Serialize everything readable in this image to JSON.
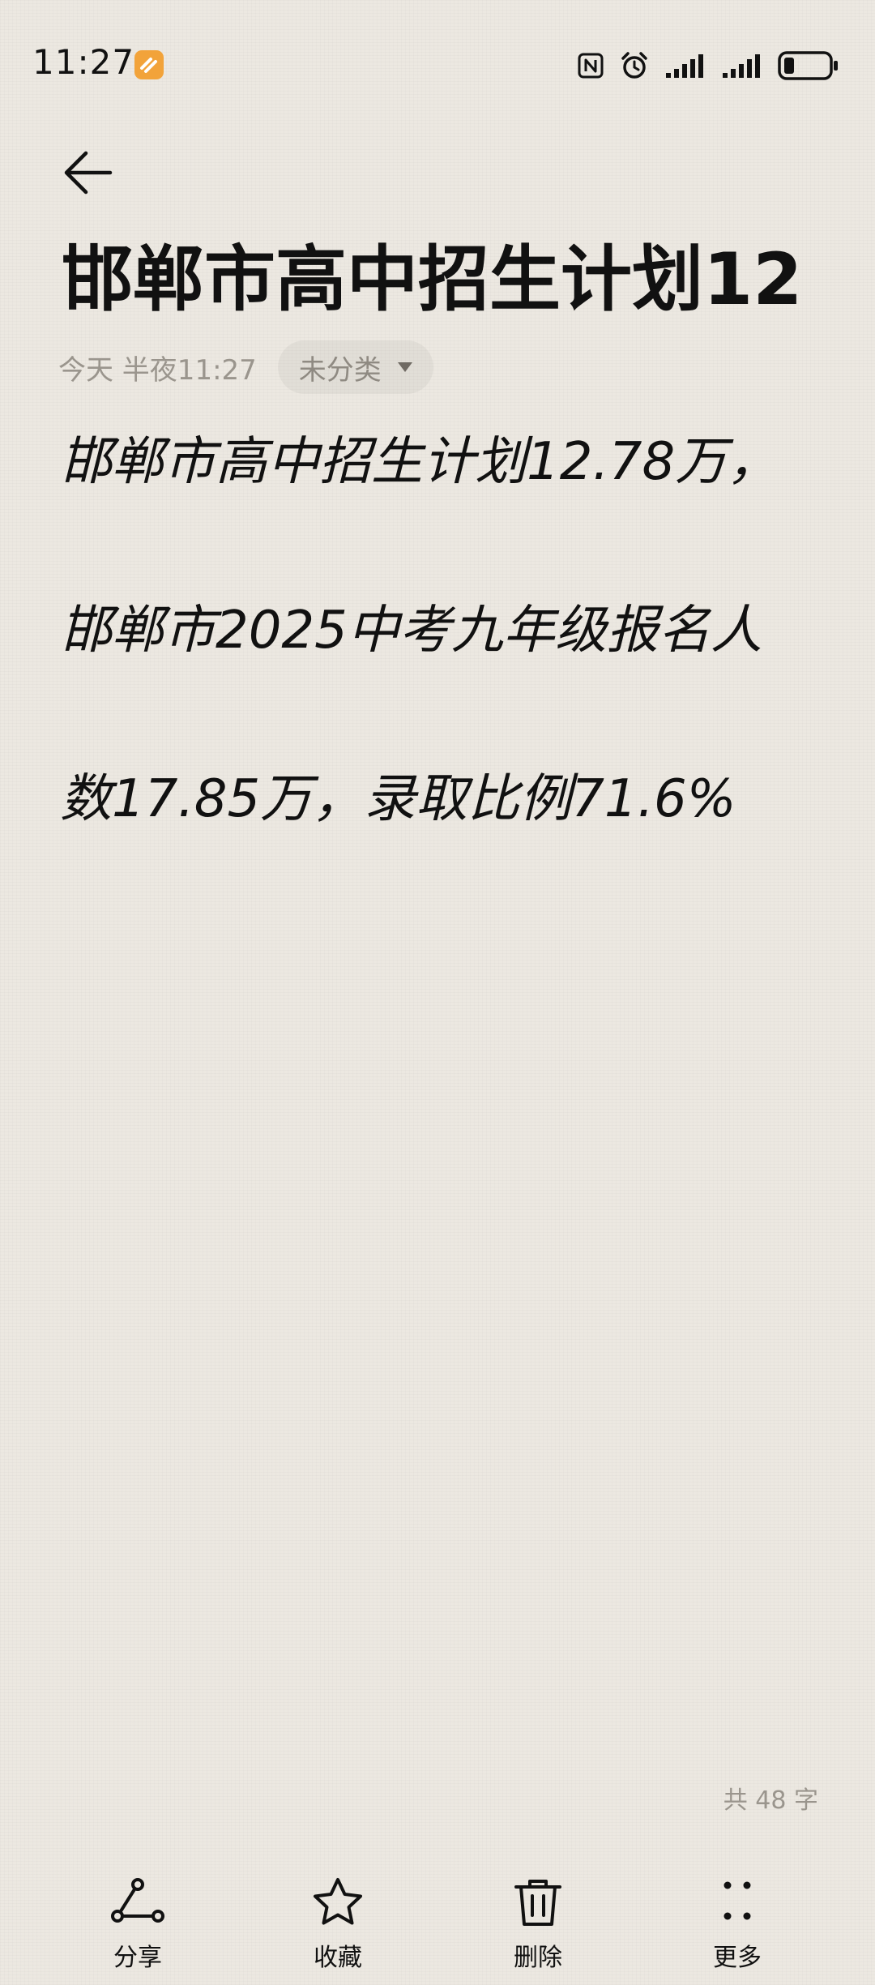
{
  "status_bar": {
    "time": "11:27",
    "icons": [
      "orange-app-icon",
      "nfc-icon",
      "alarm-icon",
      "signal-icon",
      "signal-icon",
      "battery-icon"
    ]
  },
  "header": {
    "back_icon": "arrow-left-icon",
    "title": "邯郸市高中招生计划12",
    "date": "今天 半夜11:27",
    "category": "未分类",
    "category_icon": "caret-down-icon"
  },
  "body": {
    "lines": [
      "邯郸市高中招生计划12.78万，",
      "邯郸市2025中考九年级报名人",
      "数17.85万，录取比例71.6%"
    ]
  },
  "footer": {
    "word_count": "共 48 字"
  },
  "toolbar": {
    "items": [
      {
        "label": "分享",
        "icon": "share-icon"
      },
      {
        "label": "收藏",
        "icon": "star-icon"
      },
      {
        "label": "删除",
        "icon": "trash-icon"
      },
      {
        "label": "更多",
        "icon": "more-icon"
      }
    ]
  },
  "colors": {
    "background": "#ece8e1",
    "text": "#111111",
    "secondary_text": "#9a958d",
    "app_badge": "#f2a33a"
  }
}
